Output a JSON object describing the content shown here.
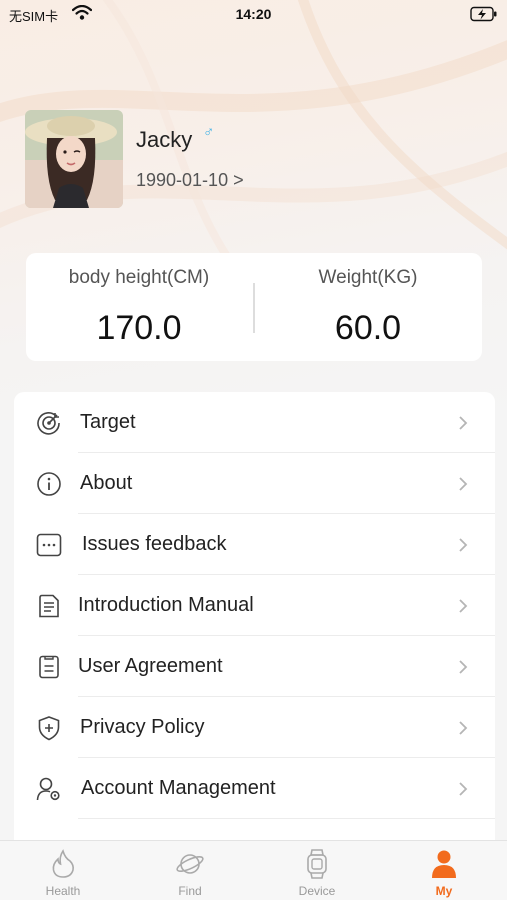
{
  "status_bar": {
    "carrier": "无SIM卡",
    "time": "14:20"
  },
  "profile": {
    "name": "Jacky",
    "gender_symbol": "♂",
    "birthdate": "1990-01-10 >"
  },
  "stats": {
    "height_label": "body height(CM)",
    "height_value": "170.0",
    "weight_label": "Weight(KG)",
    "weight_value": "60.0"
  },
  "menu": {
    "items": [
      {
        "label": "Target",
        "icon": "target-icon"
      },
      {
        "label": "About",
        "icon": "info-icon"
      },
      {
        "label": "Issues feedback",
        "icon": "feedback-icon"
      },
      {
        "label": "Introduction Manual",
        "icon": "document-icon"
      },
      {
        "label": "User Agreement",
        "icon": "agreement-icon"
      },
      {
        "label": "Privacy Policy",
        "icon": "shield-icon"
      },
      {
        "label": "Account Management",
        "icon": "account-settings-icon"
      }
    ]
  },
  "tabs": [
    {
      "label": "Health",
      "icon": "flame-icon"
    },
    {
      "label": "Find",
      "icon": "planet-icon"
    },
    {
      "label": "Device",
      "icon": "watch-icon"
    },
    {
      "label": "My",
      "icon": "person-icon",
      "active": true
    }
  ],
  "colors": {
    "accent": "#f26b1d",
    "gender_male": "#3fb1e6"
  }
}
